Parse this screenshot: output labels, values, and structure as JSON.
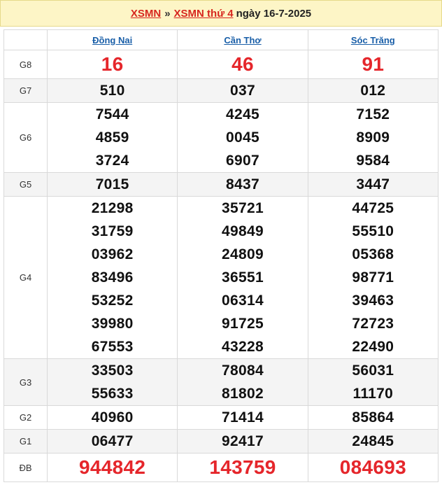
{
  "header": {
    "link1": "XSMN",
    "separator": "»",
    "link2": "XSMN thứ 4",
    "date": "ngày 16-7-2025"
  },
  "provinces": [
    "Đồng Nai",
    "Cần Thơ",
    "Sóc Trăng"
  ],
  "prizes": [
    {
      "label": "G8",
      "values": [
        [
          "16"
        ],
        [
          "46"
        ],
        [
          "91"
        ]
      ]
    },
    {
      "label": "G7",
      "values": [
        [
          "510"
        ],
        [
          "037"
        ],
        [
          "012"
        ]
      ]
    },
    {
      "label": "G6",
      "values": [
        [
          "7544",
          "4859",
          "3724"
        ],
        [
          "4245",
          "0045",
          "6907"
        ],
        [
          "7152",
          "8909",
          "9584"
        ]
      ]
    },
    {
      "label": "G5",
      "values": [
        [
          "7015"
        ],
        [
          "8437"
        ],
        [
          "3447"
        ]
      ]
    },
    {
      "label": "G4",
      "values": [
        [
          "21298",
          "31759",
          "03962",
          "83496",
          "53252",
          "39980",
          "67553"
        ],
        [
          "35721",
          "49849",
          "24809",
          "36551",
          "06314",
          "91725",
          "43228"
        ],
        [
          "44725",
          "55510",
          "05368",
          "98771",
          "39463",
          "72723",
          "22490"
        ]
      ]
    },
    {
      "label": "G3",
      "values": [
        [
          "33503",
          "55633"
        ],
        [
          "78084",
          "81802"
        ],
        [
          "56031",
          "11170"
        ]
      ]
    },
    {
      "label": "G2",
      "values": [
        [
          "40960"
        ],
        [
          "71414"
        ],
        [
          "85864"
        ]
      ]
    },
    {
      "label": "G1",
      "values": [
        [
          "06477"
        ],
        [
          "92417"
        ],
        [
          "24845"
        ]
      ]
    },
    {
      "label": "ĐB",
      "values": [
        [
          "944842"
        ],
        [
          "143759"
        ],
        [
          "084693"
        ]
      ]
    }
  ],
  "colors": {
    "highlight": "#e5262b",
    "link_red": "#d7261e",
    "link_blue": "#1a5fa8",
    "header_bg": "#fdf5c6",
    "alt_row_bg": "#f4f4f4"
  }
}
